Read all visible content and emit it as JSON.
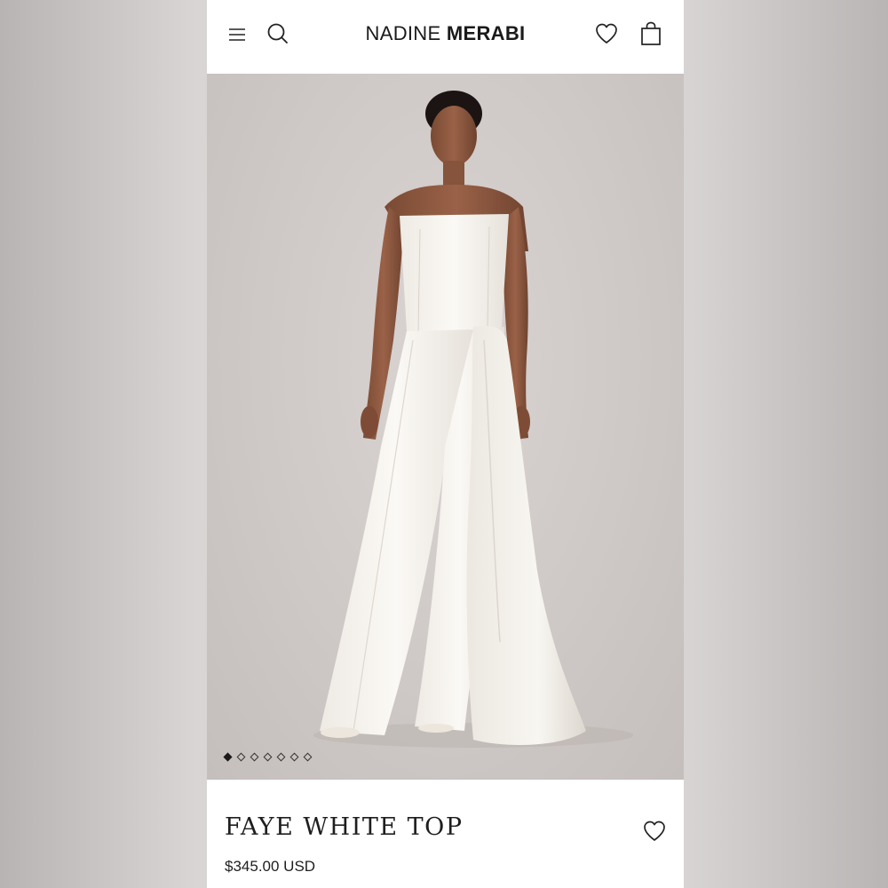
{
  "header": {
    "brand_light": "NADINE",
    "brand_bold": "MERABI",
    "icons": {
      "menu": "hamburger-menu-icon",
      "search": "search-icon",
      "wishlist": "heart-icon",
      "cart": "shopping-bag-icon"
    }
  },
  "gallery": {
    "image": "model-wearing-white-strapless-jumpsuit-with-drape",
    "slides": [
      true,
      false,
      false,
      false,
      false,
      false,
      false
    ]
  },
  "product": {
    "title": "FAYE WHITE TOP",
    "price": "$345.00 USD",
    "wishlist_icon": "heart-icon"
  },
  "colors": {
    "text": "#1a1a1a",
    "background": "#ffffff",
    "hero_bg": "#cec8c6"
  }
}
